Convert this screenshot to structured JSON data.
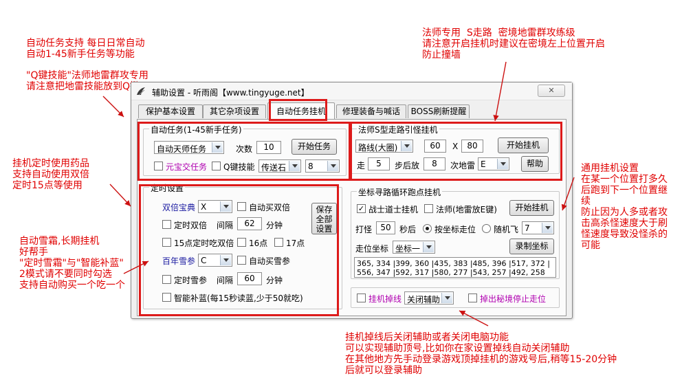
{
  "annotations": {
    "auto_task": "自动任务支持 每日日常自动\n自动1-45新手任务等功能",
    "q_skill": "\"Q键技能\"法师地雷群攻专用\n请注意把地雷技能放到Q键",
    "timer_potion": "挂机定时使用药品\n支持自动使用双倍\n定时15点等使用",
    "snow_ginseng": "自动雪霜,长期挂机\n好帮手\n\"定时雪霜\"与\"智能补蓝\"\n2模式请不要同时勾选\n支持自动购买一个吃一个",
    "mage_s_route": "法师专用  S走路  密境地雷群攻练级\n请注意开启挂机时建议在密境左上位置开启\n防止撞墙",
    "general_hang": "通用挂机设置\n在某一个位置打多久\n后跑到下一个位置继\n续\n防止因为人多或者攻\n击高杀怪速度大于刷\n怪速度导致没怪杀的\n可能",
    "disconnect": "挂机掉线后关闭辅助或者关闭电脑功能\n可以实现辅助顶号,比如你在家设置掉线自动关闭辅助\n在其他地方先手动登录游戏顶掉挂机的游戏号后,稍等15-20分钟\n后就可以登录辅助"
  },
  "window": {
    "title": "辅助设置 - 听雨阁【www.tingyuge.net】",
    "close_label": "✕"
  },
  "tabs": [
    "保护基本设置",
    "其它杂项设置",
    "自动任务挂机",
    "修理装备与喊话",
    "BOSS刷新提醒"
  ],
  "active_tab": 2,
  "auto_task": {
    "group_title": "自动任务(1-45新手任务)",
    "task_select": "自动天师任务",
    "count_label": "次数",
    "count_value": "10",
    "start_button": "开始任务",
    "yuanbao_label": "元宝交任务",
    "q_skill_label": "Q键技能",
    "item_select": "传送石",
    "key_select": "8"
  },
  "timer": {
    "group_title": "定时设置",
    "double_label": "双倍宝典",
    "double_select": "X",
    "auto_buy_double": "自动买双倍",
    "timed_double": "定时双倍",
    "interval_label": "间隔",
    "interval_value": "62",
    "minutes_label": "分钟",
    "fifteen_double": "15点定时吃双倍",
    "sixteen": "16点",
    "seventeen": "17点",
    "snow_label": "百年雪参",
    "snow_select": "C",
    "auto_buy_snow": "自动买雪参",
    "timed_snow": "定时雪参",
    "snow_interval_label": "间隔",
    "snow_interval_value": "60",
    "snow_minutes_label": "分钟",
    "smart_mana": "智能补蓝(每15秒读蓝,少于50就吃)",
    "save_button": "保存\n全部\n设置"
  },
  "mage": {
    "group_title": "法师S型走路引怪挂机",
    "route_select": "路线(大圈)",
    "x_value": "60",
    "x_sep": "X",
    "y_value": "80",
    "start_button": "开始挂机",
    "walk_label": "走",
    "walk_value": "5",
    "step_label": "步后放",
    "step_value": "8",
    "mine_label": "次地雷",
    "mine_select": "E",
    "help_button": "帮助"
  },
  "coord_hang": {
    "group_title": "坐标寻路循环跑点挂机",
    "warrior_label": "战士道士挂机",
    "mage_label": "法师(地雷放E键)",
    "start_button": "开始挂机",
    "fight_label": "打怪",
    "fight_value": "50",
    "seconds_label": "秒后",
    "by_coord_label": "按坐标走位",
    "random_fly_label": "随机飞",
    "fly_select": "7",
    "walk_coord_label": "走位坐标",
    "coord_select": "坐标一",
    "record_button": "录制坐标",
    "coord_text": "365, 334 |399, 360 |435, 383 |485, 396 |517, 372 |\n556, 347 |592, 317 |580, 277 |543, 257 |492, 258"
  },
  "bottom": {
    "drop_label": "挂机掉线",
    "drop_select": "关闭辅助",
    "secret_stop": "掉出秘境停止走位"
  }
}
